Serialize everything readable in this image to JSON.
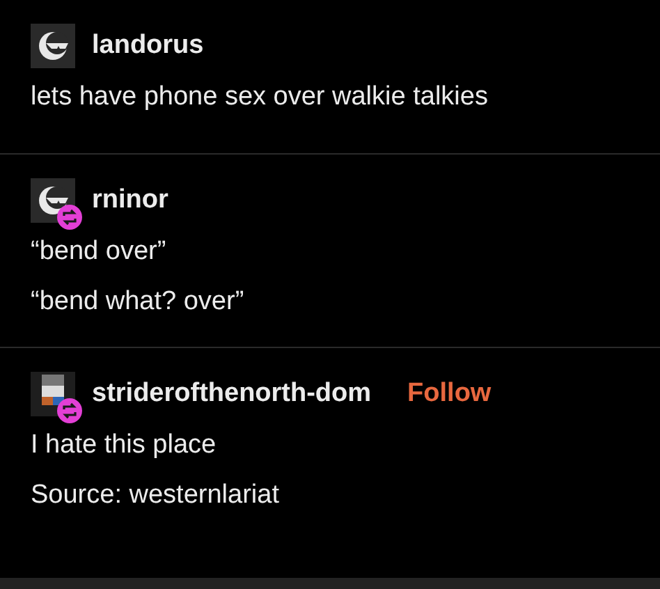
{
  "posts": [
    {
      "avatar": {
        "kind": "sunglasses"
      },
      "username": "landorus",
      "reblogged": false,
      "lines": [
        "lets have phone sex over walkie talkies"
      ]
    },
    {
      "avatar": {
        "kind": "sunglasses"
      },
      "username": "rninor",
      "reblogged": true,
      "lines": [
        "“bend over”",
        "“bend what? over”"
      ]
    },
    {
      "avatar": {
        "kind": "pixel"
      },
      "username": "striderofthenorth-dom",
      "reblogged": true,
      "follow": "Follow",
      "lines": [
        "I hate this place",
        "Source: westernlariat"
      ]
    }
  ]
}
